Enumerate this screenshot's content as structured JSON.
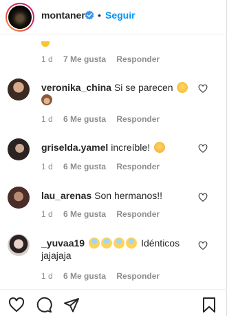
{
  "header": {
    "username": "montaner",
    "separator": "•",
    "follow_label": "Seguir"
  },
  "previous_comment_meta": {
    "time": "1 d",
    "likes": "7 Me gusta",
    "reply": "Responder"
  },
  "comments": [
    {
      "username": "veronika_china",
      "text": "Si se parecen",
      "time": "1 d",
      "likes": "6 Me gusta",
      "reply": "Responder"
    },
    {
      "username": "griselda.yamel",
      "text": "increíble!",
      "time": "1 d",
      "likes": "6 Me gusta",
      "reply": "Responder"
    },
    {
      "username": "lau_arenas",
      "text": "Son hermanos!!",
      "time": "1 d",
      "likes": "6 Me gusta",
      "reply": "Responder"
    },
    {
      "username": "_yuvaa19",
      "text": "Idénticos jajajaja",
      "time": "1 d",
      "likes": "6 Me gusta",
      "reply": "Responder"
    }
  ],
  "icons": {
    "verified": "verified-badge-icon",
    "heart": "heart-outline-icon",
    "comment": "comment-bubble-icon",
    "share": "paper-plane-icon",
    "save": "bookmark-icon"
  },
  "colors": {
    "follow": "#0095f6",
    "muted": "#8e8e8e",
    "text": "#262626"
  }
}
